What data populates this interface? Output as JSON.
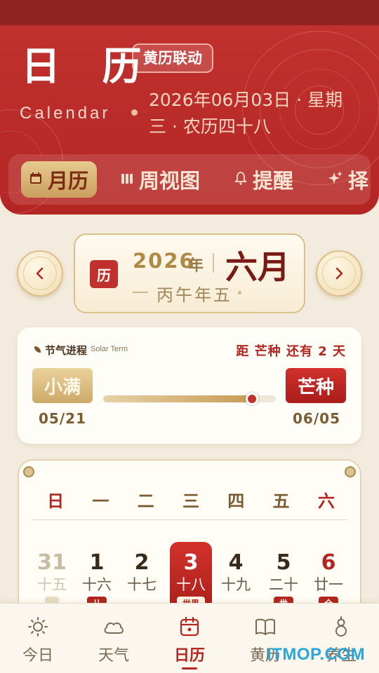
{
  "header": {
    "title": "日 历",
    "badge": "黄历联动",
    "subtitle_en": "Calendar",
    "date_line": "2026年06月03日 · 星期三 · 农历四十八"
  },
  "tabs": [
    {
      "icon": "calendar-icon",
      "label": "月历",
      "active": true
    },
    {
      "icon": "week-view-icon",
      "label": "周视图",
      "active": false
    },
    {
      "icon": "bell-icon",
      "label": "提醒",
      "active": false
    },
    {
      "icon": "sparkle-icon",
      "label": "择",
      "active": false
    }
  ],
  "month_selector": {
    "badge": "历",
    "year": "2026",
    "year_unit": "年",
    "month": "六月",
    "ganzhi": "丙午年五"
  },
  "solar_term": {
    "label": "节气进程",
    "label_en": "Solar Term",
    "countdown": "距 芒种 还有 2 天",
    "prev": {
      "name": "小满",
      "date": "05/21"
    },
    "next": {
      "name": "芒种",
      "date": "06/05"
    },
    "progress": 0.86
  },
  "calendar": {
    "weekdays": [
      "日",
      "一",
      "二",
      "三",
      "四",
      "五",
      "六"
    ],
    "days": [
      {
        "day": "31",
        "lunar": "十五",
        "tag": "",
        "state": "muted"
      },
      {
        "day": "1",
        "lunar": "十六",
        "tag": "儿",
        "state": "normal"
      },
      {
        "day": "2",
        "lunar": "十七",
        "tag": "",
        "state": "normal"
      },
      {
        "day": "3",
        "lunar": "十八",
        "tag": "世界",
        "state": "today"
      },
      {
        "day": "4",
        "lunar": "十九",
        "tag": "",
        "state": "normal"
      },
      {
        "day": "5",
        "lunar": "二十",
        "tag": "世",
        "state": "normal"
      },
      {
        "day": "6",
        "lunar": "廿一",
        "tag": "全",
        "state": "red"
      }
    ]
  },
  "bottom_nav": [
    {
      "icon": "sun-icon",
      "label": "今日",
      "active": false
    },
    {
      "icon": "cloud-icon",
      "label": "天气",
      "active": false
    },
    {
      "icon": "calendar-icon",
      "label": "日历",
      "active": true
    },
    {
      "icon": "book-icon",
      "label": "黄历",
      "active": false
    },
    {
      "icon": "gourd-icon",
      "label": "养生",
      "active": false
    }
  ],
  "watermark": "ITMOP.COM",
  "colors": {
    "primary_red": "#b2271f",
    "header_red": "#c0312e",
    "gold": "#c99f5d",
    "background": "#f3ebdd"
  }
}
